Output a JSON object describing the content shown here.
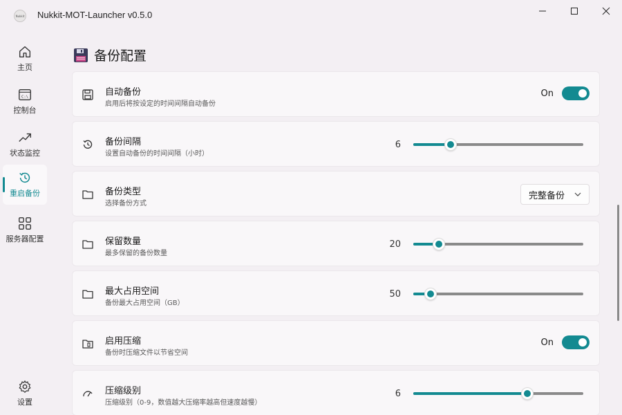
{
  "window": {
    "title": "Nukkit-MOT-Launcher v0.5.0",
    "logo_text": "Nukkit"
  },
  "colors": {
    "accent": "#138a91",
    "background": "#f3eff3",
    "card": "#f9f7f9"
  },
  "sidebar": {
    "items": [
      {
        "label": "主页",
        "icon": "home-icon",
        "active": false
      },
      {
        "label": "控制台",
        "icon": "console-icon",
        "active": false
      },
      {
        "label": "状态监控",
        "icon": "trend-icon",
        "active": false
      },
      {
        "label": "重启备份",
        "icon": "history-icon",
        "active": true
      },
      {
        "label": "服务器配置",
        "icon": "grid-icon",
        "active": false
      }
    ],
    "settings": {
      "label": "设置",
      "icon": "gear-icon"
    }
  },
  "page": {
    "title": "备份配置",
    "icon": "floppy-icon"
  },
  "settings": [
    {
      "title": "自动备份",
      "desc": "启用后将按设定的时间间隔自动备份",
      "control": "toggle",
      "value": "On",
      "icon": "save-icon"
    },
    {
      "title": "备份间隔",
      "desc": "设置自动备份的时间间隔（小时）",
      "control": "slider",
      "value": "6",
      "fraction": 0.22,
      "icon": "history-icon"
    },
    {
      "title": "备份类型",
      "desc": "选择备份方式",
      "control": "dropdown",
      "value": "完整备份",
      "icon": "folder-icon"
    },
    {
      "title": "保留数量",
      "desc": "最多保留的备份数量",
      "control": "slider",
      "value": "20",
      "fraction": 0.15,
      "icon": "folder-icon"
    },
    {
      "title": "最大占用空间",
      "desc": "备份最大占用空间（GB）",
      "control": "slider",
      "value": "50",
      "fraction": 0.1,
      "icon": "folder-icon"
    },
    {
      "title": "启用压缩",
      "desc": "备份时压缩文件以节省空间",
      "control": "toggle",
      "value": "On",
      "icon": "zip-folder-icon"
    },
    {
      "title": "压缩级别",
      "desc": "压缩级别（0-9，数值越大压缩率越高但速度越慢）",
      "control": "slider",
      "value": "6",
      "fraction": 0.67,
      "icon": "gauge-icon"
    }
  ]
}
